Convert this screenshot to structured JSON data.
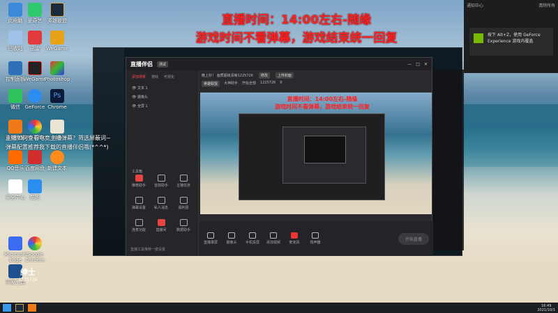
{
  "overlay": {
    "line1": "直播时间：14:00左右-随缘",
    "line2": "游戏时间不看弹幕，游戏结束统一回复"
  },
  "chat": {
    "line1": "主播如何查看电竞主播弹幕？筛选屏蔽词~",
    "line2": "弹幕配置推荐我下载的直播伴侣哦(*^^*)"
  },
  "desktop_icons": [
    {
      "label": "此电脑"
    },
    {
      "label": "爱奇艺"
    },
    {
      "label": "英雄联盟"
    },
    {
      "label": "回收站"
    },
    {
      "label": "迅雷"
    },
    {
      "label": "WeGame"
    },
    {
      "label": "控制面板"
    },
    {
      "label": "WeGame"
    },
    {
      "label": "Photoshop"
    },
    {
      "label": "微信"
    },
    {
      "label": "GeForce"
    },
    {
      "label": "Chrome"
    },
    {
      "label": "直播伴侣"
    },
    {
      "label": "WPS Office"
    },
    {
      "label": "斗鱼"
    },
    {
      "label": "QQ音乐"
    },
    {
      "label": "百度网盘"
    },
    {
      "label": "新建文本"
    },
    {
      "label": "安全中心"
    },
    {
      "label": "酷狗"
    },
    {
      "label": "Microsoft Edge"
    },
    {
      "label": "Google Chrome"
    },
    {
      "label": "开发工具"
    }
  ],
  "obs": {
    "title": "直播伴侣",
    "badge": "测试",
    "tabs": [
      "添加场景",
      "游戏",
      "可视化"
    ],
    "scenes": [
      "文本 1",
      "摄像头",
      "全屏 1"
    ],
    "tools_title": "工具箱",
    "tools": [
      "推荐助手",
      "音效助手",
      "主播任务",
      "弹幕设置",
      "私人消息",
      "福利团",
      "连麦功能",
      "直播间",
      "数据助手"
    ],
    "footer_note": "直播工具推荐一键设置",
    "stream_title": "晚上好！ 画质超级清晰1225726",
    "edit_label": "修改",
    "upload_label": "上传封面",
    "category_label": "英雄联盟",
    "area_label": "大神助手",
    "room_label": "开始全部",
    "viewers": "1225726",
    "likes": "0",
    "bottom_buttons": [
      "直播录屏",
      "摄像头",
      "手机投屏",
      "添加视频",
      "麦克风",
      "扬声器"
    ],
    "start_live": "开始直播"
  },
  "notification": {
    "header": "通知中心",
    "close": "清除所有",
    "message": "按下 Alt+Z，使用 GeForce Experience 游戏内覆盖"
  },
  "taskbar": {
    "time": "16:49",
    "date": "2021/10/1"
  },
  "watermark": {
    "line1": "绅士",
    "line2": "1225726"
  }
}
